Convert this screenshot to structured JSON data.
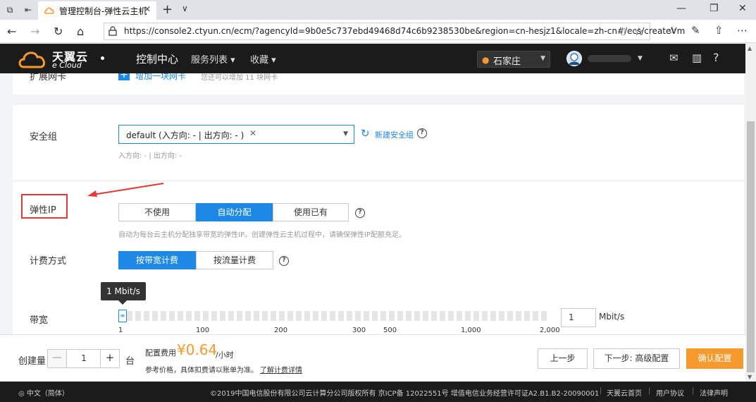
{
  "browser": {
    "tab_title": "管理控制台-弹性云主机",
    "url": "https://console2.ctyun.cn/ecm/?agencyId=9b0e5c737ebd49468d74c6b9238530be&region=cn-hesjz1&locale=zh-cn#/ecs/createVm"
  },
  "header": {
    "logo_cn": "天翼云",
    "logo_en": "e Cloud",
    "console": "控制中心",
    "services": "服务列表 ▾",
    "favorites": "收藏 ▾",
    "region": "石家庄"
  },
  "section_top": {
    "label": "扩展网卡",
    "add_link": "增加一块网卡",
    "hint": "您还可以增加 11 块网卡"
  },
  "security": {
    "label": "安全组",
    "selected": "default (入方向: - | 出方向: - )",
    "new_link": "新建安全组",
    "rules": "入方向: - | 出方向: -"
  },
  "eip": {
    "label": "弹性IP",
    "options": [
      "不使用",
      "自动分配",
      "使用已有"
    ],
    "selected": "自动分配",
    "hint": "自动为每台云主机分配独享带宽的弹性IP。创建弹性云主机过程中，请确保弹性IP配额充足。"
  },
  "billing": {
    "label": "计费方式",
    "options": [
      "按带宽计费",
      "按流量计费"
    ],
    "selected": "按带宽计费"
  },
  "bandwidth": {
    "label": "带宽",
    "tooltip": "1 Mbit/s",
    "value": 1,
    "min": 1,
    "max": 2000,
    "ticks": [
      "1",
      "100",
      "200",
      "300",
      "500",
      "1,000",
      "2,000"
    ],
    "input_value": "1",
    "unit": "Mbit/s"
  },
  "order": {
    "qty_label": "创建量",
    "qty": "1",
    "qty_unit": "台",
    "fee_label": "配置费用",
    "fee": "¥0.64",
    "fee_unit": "/小时",
    "ref_note": "参考价格，具体扣费请以账单为准。",
    "ref_link": "了解计费详情",
    "prev": "上一步",
    "next": "下一步: 高级配置",
    "confirm": "确认配置"
  },
  "footer": {
    "lang": "中文（简体）",
    "copyright": "©2019中国电信股份有限公司云计算分公司版权所有  京ICP备 12022551号  增值电信业务经营许可证A2.B1.B2-20090001",
    "links": [
      "天翼云首页",
      "用户协议",
      "法律声明"
    ]
  },
  "colors": {
    "accent": "#1e88e5",
    "brand": "#f79a2e",
    "annotation": "#e53935"
  },
  "icons": [
    "tab-overview-icon",
    "back-icon",
    "forward-icon",
    "refresh-icon",
    "home-icon",
    "lock-icon",
    "star-icon",
    "location-icon",
    "mail-icon",
    "chart-icon",
    "help-icon"
  ]
}
